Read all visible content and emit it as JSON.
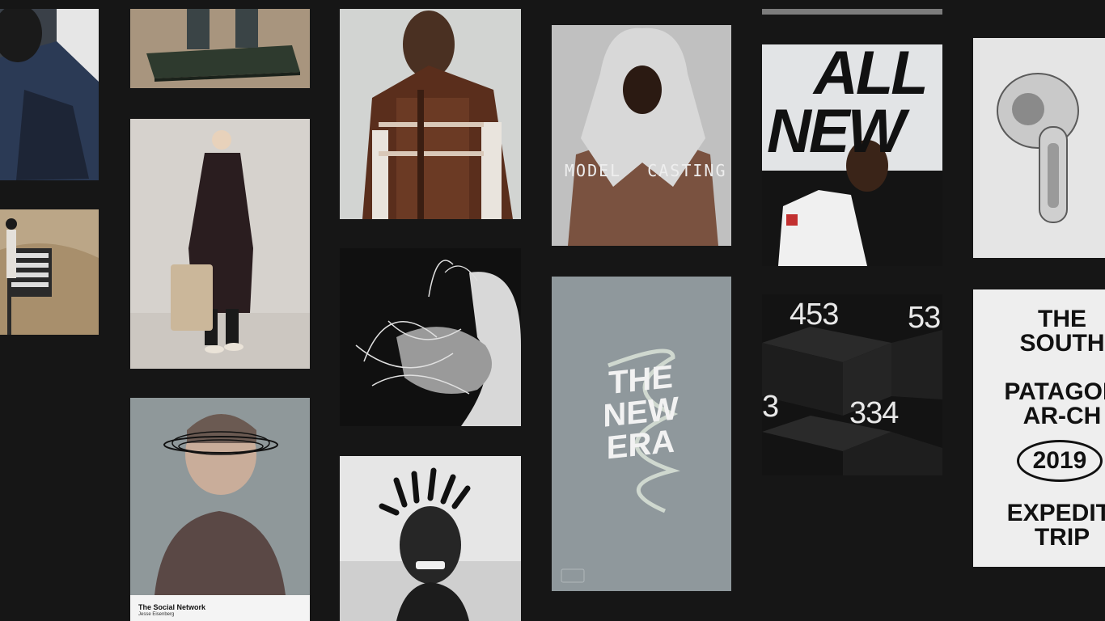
{
  "model_casting": {
    "word1": "MODEL",
    "word2": "CASTING"
  },
  "all_new": {
    "line1": "ALL",
    "line2": "NEW"
  },
  "new_era": {
    "line1": "THE",
    "line2": "NEW",
    "line3": "ERA"
  },
  "numbers_poster": {
    "n1": "453",
    "n2": "53",
    "n3": "3",
    "n4": "334"
  },
  "south_poster": {
    "line1": "THE",
    "line2": "SOUTH",
    "line3": "PATAGON",
    "line4": "AR-CH",
    "year": "2019",
    "line5": "EXPEDITI",
    "line6": "TRIP"
  },
  "social_network": {
    "title": "The Social Network",
    "subtitle": "Jesse Eisenberg"
  },
  "colors": {
    "background": "#161616",
    "poster_gray": "#8e979b",
    "paper": "#eeeeee"
  }
}
